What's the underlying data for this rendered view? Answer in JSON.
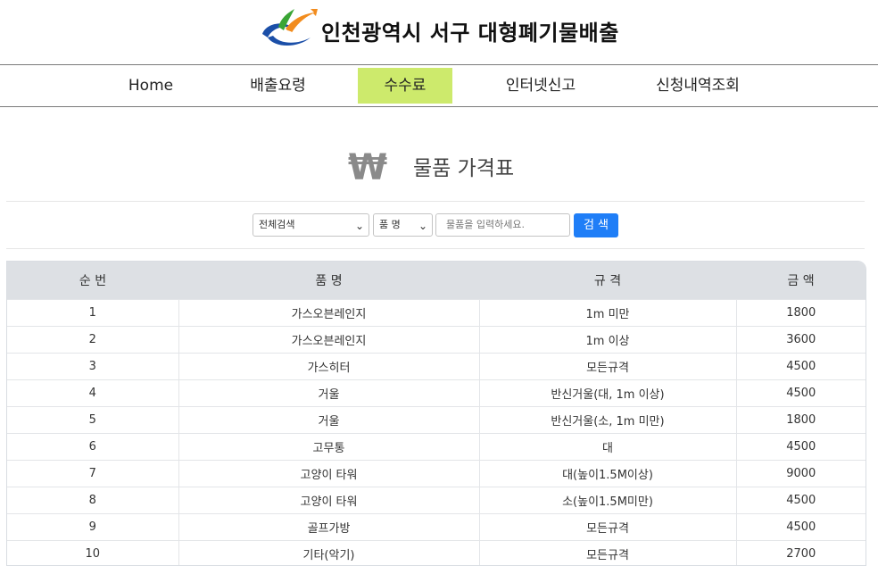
{
  "header": {
    "site_title": "인천광역시 서구  대형폐기물배출"
  },
  "nav": [
    {
      "label": "Home",
      "active": false
    },
    {
      "label": "배출요령",
      "active": false
    },
    {
      "label": "수수료",
      "active": true
    },
    {
      "label": "인터넷신고",
      "active": false
    },
    {
      "label": "신청내역조회",
      "active": false
    }
  ],
  "page": {
    "title_icon": "₩",
    "title": "물품 가격표"
  },
  "search": {
    "category_select": "전체검색",
    "field_select": "품 명",
    "input_placeholder": "물품을 입력하세요.",
    "button_label": "검 색"
  },
  "table": {
    "headers": [
      "순 번",
      "품 명",
      "규 격",
      "금 액"
    ],
    "rows": [
      [
        "1",
        "가스오븐레인지",
        "1m 미만",
        "1800"
      ],
      [
        "2",
        "가스오븐레인지",
        "1m 이상",
        "3600"
      ],
      [
        "3",
        "가스히터",
        "모든규격",
        "4500"
      ],
      [
        "4",
        "거울",
        "반신거울(대, 1m 이상)",
        "4500"
      ],
      [
        "5",
        "거울",
        "반신거울(소, 1m 미만)",
        "1800"
      ],
      [
        "6",
        "고무통",
        "대",
        "4500"
      ],
      [
        "7",
        "고양이 타워",
        "대(높이1.5M이상)",
        "9000"
      ],
      [
        "8",
        "고양이 타워",
        "소(높이1.5M미만)",
        "4500"
      ],
      [
        "9",
        "골프가방",
        "모든규격",
        "4500"
      ],
      [
        "10",
        "기타(악기)",
        "모든규격",
        "2700"
      ]
    ]
  },
  "colors": {
    "nav_active": "#cdea6c",
    "search_button": "#1f7ef7",
    "table_header": "#dde0e4",
    "logo_blue": "#1b4fa8",
    "logo_green": "#3aa535",
    "logo_orange": "#f28c1e"
  }
}
